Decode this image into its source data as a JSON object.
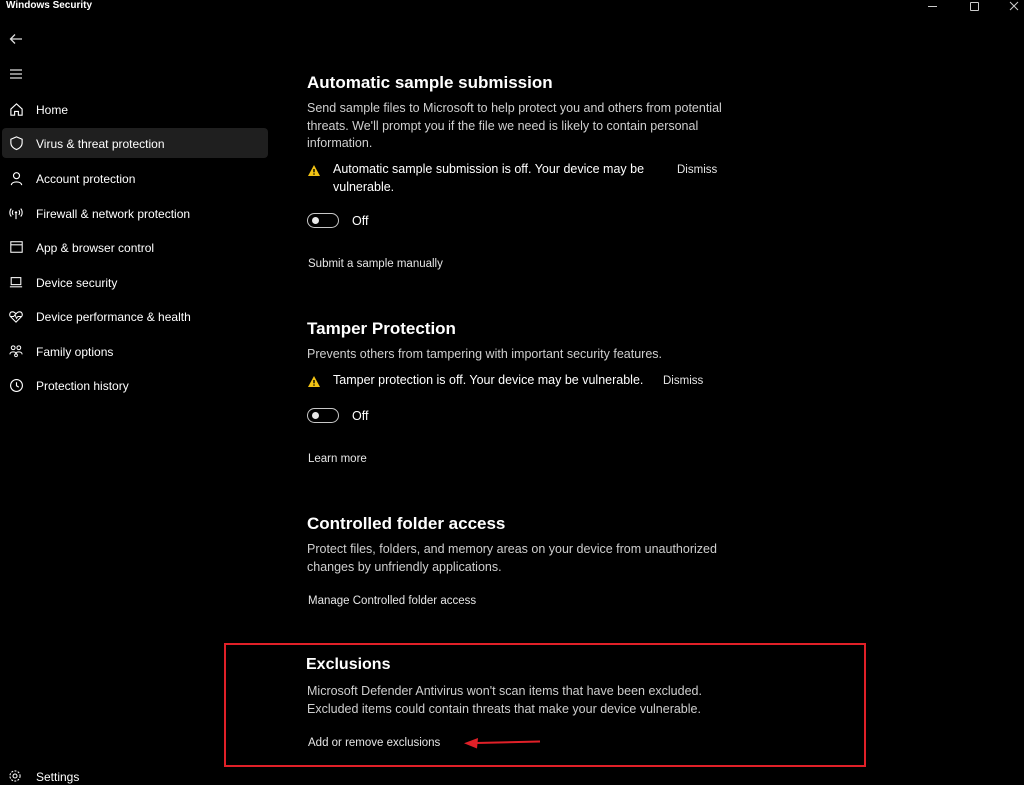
{
  "window": {
    "title": "Windows Security"
  },
  "sidebar": {
    "items": [
      {
        "label": "Home",
        "icon": "home-icon"
      },
      {
        "label": "Virus & threat protection",
        "icon": "shield-icon",
        "active": true
      },
      {
        "label": "Account protection",
        "icon": "person-icon"
      },
      {
        "label": "Firewall & network protection",
        "icon": "antenna-icon"
      },
      {
        "label": "App & browser control",
        "icon": "browser-window-icon"
      },
      {
        "label": "Device security",
        "icon": "laptop-icon"
      },
      {
        "label": "Device performance & health",
        "icon": "heart-pulse-icon"
      },
      {
        "label": "Family options",
        "icon": "family-icon"
      },
      {
        "label": "Protection history",
        "icon": "history-icon"
      }
    ],
    "settings_label": "Settings"
  },
  "sections": {
    "sample": {
      "title": "Automatic sample submission",
      "description": "Send sample files to Microsoft to help protect you and others from potential threats. We'll prompt you if the file we need is likely to contain personal information.",
      "warning": "Automatic sample submission is off. Your device may be vulnerable.",
      "dismiss": "Dismiss",
      "toggle_label": "Off",
      "link": "Submit a sample manually"
    },
    "tamper": {
      "title": "Tamper Protection",
      "description": "Prevents others from tampering with important security features.",
      "warning": "Tamper protection is off. Your device may be vulnerable.",
      "dismiss": "Dismiss",
      "toggle_label": "Off",
      "link": "Learn more"
    },
    "folder": {
      "title": "Controlled folder access",
      "description": "Protect files, folders, and memory areas on your device from unauthorized changes by unfriendly applications.",
      "link": "Manage Controlled folder access"
    },
    "exclusions": {
      "title": "Exclusions",
      "description": "Microsoft Defender Antivirus won't scan items that have been excluded. Excluded items could contain threats that make your device vulnerable.",
      "link": "Add or remove exclusions"
    }
  },
  "colors": {
    "background": "#000000",
    "highlight": "#e02028",
    "warning": "#f2c314"
  }
}
